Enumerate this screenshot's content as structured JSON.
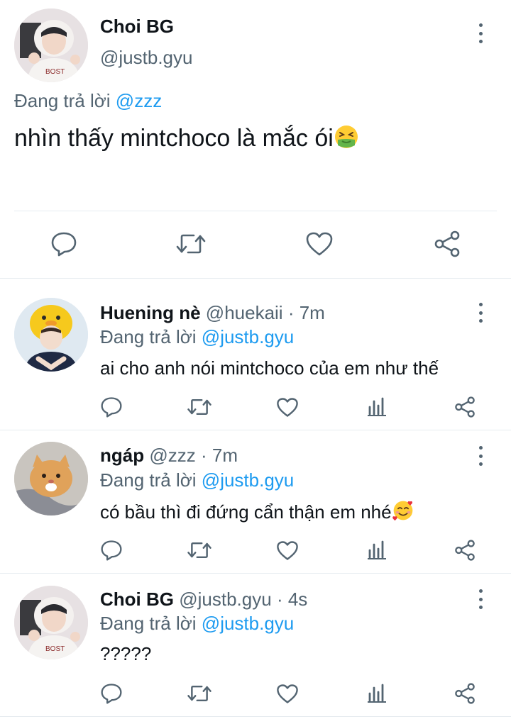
{
  "main_tweet": {
    "display_name": "Choi BG",
    "handle": "@justb.gyu",
    "replying_prefix": "Đang trả lời",
    "replying_to": "@zzz",
    "text": "nhìn thấy mintchoco là mắc ói",
    "emoji": "nauseated-face"
  },
  "replies": [
    {
      "display_name": "Huening nè",
      "handle": "@huekaii",
      "time": "· 7m",
      "replying_prefix": "Đang trả lời",
      "replying_to": "@justb.gyu",
      "text": "ai cho anh nói mintchoco của em như thế"
    },
    {
      "display_name": "ngáp",
      "handle": "@zzz",
      "time": "· 7m",
      "replying_prefix": "Đang trả lời",
      "replying_to": "@justb.gyu",
      "text": "có bầu thì đi đứng cẩn thận em nhé",
      "emoji": "smiling-face-with-hearts"
    },
    {
      "display_name": "Choi BG",
      "handle": "@justb.gyu",
      "time": "· 4s",
      "replying_prefix": "Đang trả lời",
      "replying_to": "@justb.gyu",
      "text": "?????"
    }
  ],
  "colors": {
    "text": "#0f1419",
    "muted": "#536471",
    "link": "#1d9bf0",
    "divider": "#e6ecf0"
  }
}
